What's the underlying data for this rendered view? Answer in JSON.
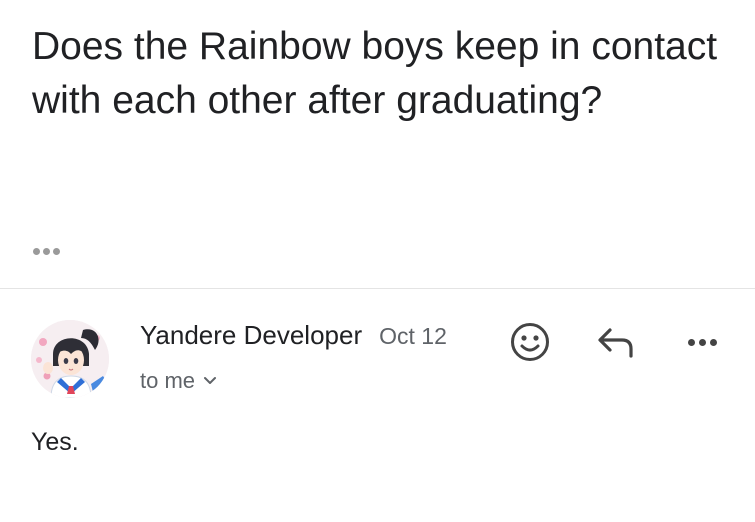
{
  "thread": {
    "subject": "Does the Rainbow boys keep in contact with each other after graduating?"
  },
  "message": {
    "sender_name": "Yandere Developer",
    "date": "Oct 12",
    "recipient": "to me",
    "body": "Yes."
  },
  "icons": {
    "collapsed": "more-horizontal-icon",
    "avatar": "anime-schoolgirl-avatar",
    "recipient_toggle": "chevron-down-icon",
    "emoji": "smiley-face-icon",
    "reply": "reply-arrow-icon",
    "more": "more-horizontal-icon"
  },
  "colors": {
    "text": "#202124",
    "secondary": "#5f6368",
    "divider": "#e4e4e4"
  }
}
